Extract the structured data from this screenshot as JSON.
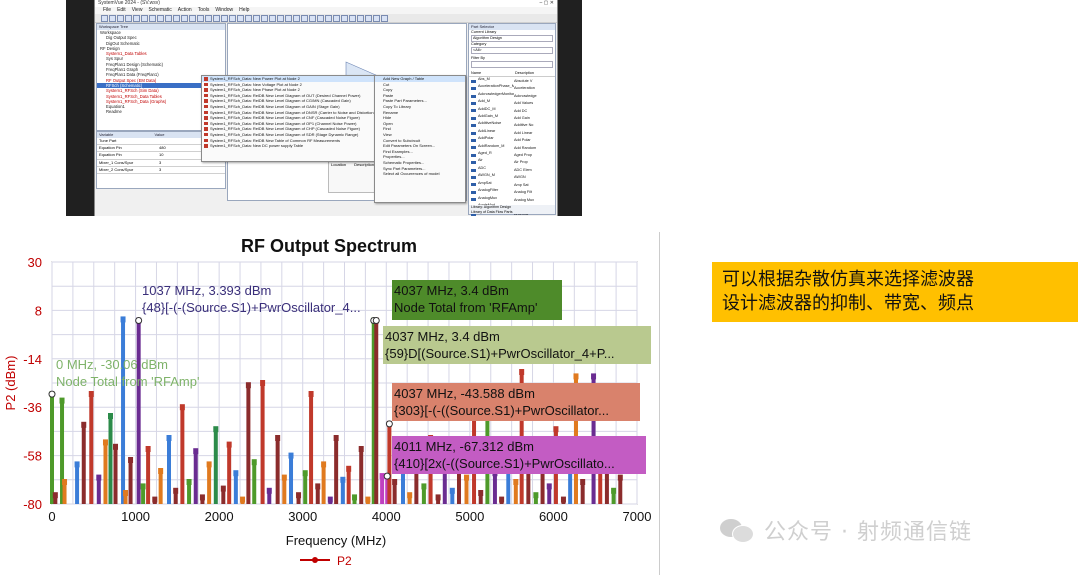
{
  "app": {
    "title": "SystemVue 2024 - (SV.wsv)",
    "menu": [
      "File",
      "Edit",
      "View",
      "Schematic",
      "Action",
      "Tools",
      "Window",
      "Help"
    ],
    "workspace_pane_title": "Workspace Tree",
    "tree": [
      {
        "label": "Workspace",
        "style": "normal"
      },
      {
        "label": "Dig Output Spec",
        "style": "normal"
      },
      {
        "label": "DigOut Schematic",
        "style": "normal"
      },
      {
        "label": "RF Design",
        "style": "normal"
      },
      {
        "label": "System1_Data Tables",
        "style": "red"
      },
      {
        "label": "Sys Spur",
        "style": "normal"
      },
      {
        "label": "FreqPlan1 Design (Schematic)",
        "style": "normal"
      },
      {
        "label": "FreqPlan1 Graph",
        "style": "normal"
      },
      {
        "label": "FreqPlan1 Data (FreqPlan1)",
        "style": "normal"
      },
      {
        "label": "RF Output Spec (EM Data)",
        "style": "red"
      },
      {
        "label": "RFSch (Schematic)",
        "style": "sel"
      },
      {
        "label": "System1_RFSch (Sim Data)",
        "style": "red"
      },
      {
        "label": "System1_RFSch_Data Tables",
        "style": "red"
      },
      {
        "label": "System1_RFSch_Data (Graphs)",
        "style": "red"
      },
      {
        "label": "Equation1",
        "style": "normal"
      },
      {
        "label": "Readme",
        "style": "normal"
      }
    ],
    "context_menu_left": [
      "System1_RFSch_Data: New Power Plot at Node 2",
      "System1_RFSch_Data: New Voltage Plot at Node 2",
      "System1_RFSch_Data: New Phase Plot at Node 2",
      "System1_RFSch_Data: RelDB New Level Diagram of OUT (Desired Channel Power)",
      "System1_RFSch_Data: RelDB New Level Diagram of CG/MN (Cascaded Gain)",
      "System1_RFSch_Data: RelDB New Level Diagram of GAIN (Stage Gain)",
      "System1_RFSch_Data: RelDB New Level Diagram of DNSR (Carrier to Noise and Distortion Ratio)",
      "System1_RFSch_Data: RelDB New Level Diagram of CNF (Cascaded Noise Figure)",
      "System1_RFSch_Data: RelDB New Level Diagram of OP1 (Channel Noise Power)",
      "System1_RFSch_Data: RelDB New Level Diagram of CHP (Cascaded Noise Figure)",
      "System1_RFSch_Data: RelDB New Level Diagram of SDR (Stage Dynamic Range)",
      "System1_RFSch_Data: RelDB New Table of Common RF Measurements",
      "System1_RFSch_Data: New DC power supply Table"
    ],
    "context_menu_right": [
      "Add New Graph / Table",
      "Cut",
      "Copy",
      "Paste",
      "Paste Part Parameters...",
      "Copy To Library",
      "Rename",
      "Hide",
      "Open",
      "Find",
      "View",
      "Convert to Subcircuit",
      "Edit Parameters On Screen...",
      "Find Examples...",
      "Properties...",
      "Schematic Properties...",
      "Sync Part Parameters...",
      "Select all Occurrences of model"
    ],
    "grid_header": [
      "Variable",
      "Value"
    ],
    "grid_rows": [
      [
        "Tune Part",
        ""
      ],
      [
        "Equation Pin",
        "480"
      ],
      [
        "Equation Pin",
        "10"
      ],
      [
        "Mixer_1 Cons/Spur",
        "3"
      ],
      [
        "Mixer_2 Cons/Spur",
        "3"
      ]
    ],
    "bottom_label": [
      "Location",
      "Description",
      "Units"
    ],
    "library_pane_title": "Part Selector",
    "library_current": "Algorithm Design",
    "library_category": "<All>",
    "library_filter_label": "Filter By",
    "library_columns": [
      "Name",
      "Description"
    ],
    "library_items": [
      [
        "Abs_M",
        "Absolute V"
      ],
      [
        "AccelerationPhase_M",
        "Acceleration"
      ],
      [
        "AcknowledgerMonitor",
        "Acknowledge"
      ],
      [
        "Add_M",
        "Add Values"
      ],
      [
        "AddDC_M",
        "Add DC"
      ],
      [
        "AddGain_M",
        "Add Gain"
      ],
      [
        "AdditiveNoise",
        "Additive No"
      ],
      [
        "AddLinear",
        "Add Linear"
      ],
      [
        "AddPolar",
        "Add Polar"
      ],
      [
        "AddRandom_M",
        "Add Random"
      ],
      [
        "Aged_R",
        "Aged Prop"
      ],
      [
        "Air",
        "Air Prop"
      ],
      [
        "ADC",
        "ADC Elem"
      ],
      [
        "AWGN_M",
        "AWGN"
      ],
      [
        "AmpSat",
        "Amp Sat"
      ],
      [
        "AnalogFilter",
        "Analog Filt"
      ],
      [
        "AnalogMux",
        "Analog Mux"
      ],
      [
        "AngleMod",
        "Angle Mod"
      ],
      [
        "Antenna",
        "Antenna"
      ],
      [
        "AntennaArray",
        "Ant Array"
      ],
      [
        "AnyFile",
        "Any File"
      ],
      [
        "ArrayPorts",
        "Array Ports"
      ],
      [
        "Attenuator",
        "Attenuator"
      ],
      [
        "Audio",
        "Audio"
      ],
      [
        "AutoCorr",
        "Auto Corr"
      ]
    ],
    "library_footer": [
      "Library: Algorithm Design",
      "Library of Data Flow Parts"
    ]
  },
  "chart_data": {
    "type": "bar",
    "title": "RF Output Spectrum",
    "xlabel": "Frequency (MHz)",
    "ylabel": "P2 (dBm)",
    "xlim": [
      0,
      7000
    ],
    "ylim": [
      -80,
      30
    ],
    "xticks": [
      "0",
      "1000",
      "2000",
      "3000",
      "4000",
      "5000",
      "6000",
      "7000"
    ],
    "yticks": [
      "30",
      "8",
      "-14",
      "-36",
      "-58",
      "-80"
    ],
    "grid": true,
    "legend": {
      "position": "bottom-center",
      "entries": [
        "P2"
      ]
    },
    "bars": [
      {
        "x": 0,
        "y": -30.06,
        "color": "#4e9a2a"
      },
      {
        "x": 40,
        "y": -76,
        "color": "#8b2c2c"
      },
      {
        "x": 120,
        "y": -33,
        "color": "#4e9a2a"
      },
      {
        "x": 150,
        "y": -70,
        "color": "#e07a1f"
      },
      {
        "x": 300,
        "y": -62,
        "color": "#3b7dd8"
      },
      {
        "x": 380,
        "y": -44,
        "color": "#8b2c2c"
      },
      {
        "x": 470,
        "y": -30,
        "color": "#c0392b"
      },
      {
        "x": 560,
        "y": -68,
        "color": "#6a2c91"
      },
      {
        "x": 640,
        "y": -52,
        "color": "#e07a1f"
      },
      {
        "x": 700,
        "y": -40,
        "color": "#2c8b4a"
      },
      {
        "x": 760,
        "y": -54,
        "color": "#8b2c2c"
      },
      {
        "x": 850,
        "y": 3.9,
        "color": "#3b7dd8"
      },
      {
        "x": 880,
        "y": -75,
        "color": "#e07a1f"
      },
      {
        "x": 940,
        "y": -60,
        "color": "#8b2c2c"
      },
      {
        "x": 1037,
        "y": 3.393,
        "color": "#6a2c91"
      },
      {
        "x": 1090,
        "y": -72,
        "color": "#4e9a2a"
      },
      {
        "x": 1150,
        "y": -55,
        "color": "#c0392b"
      },
      {
        "x": 1230,
        "y": -78,
        "color": "#8b2c2c"
      },
      {
        "x": 1300,
        "y": -65,
        "color": "#e07a1f"
      },
      {
        "x": 1400,
        "y": -50,
        "color": "#3b7dd8"
      },
      {
        "x": 1480,
        "y": -74,
        "color": "#8b2c2c"
      },
      {
        "x": 1560,
        "y": -36,
        "color": "#c0392b"
      },
      {
        "x": 1640,
        "y": -70,
        "color": "#4e9a2a"
      },
      {
        "x": 1720,
        "y": -56,
        "color": "#6a2c91"
      },
      {
        "x": 1800,
        "y": -77,
        "color": "#8b2c2c"
      },
      {
        "x": 1880,
        "y": -62,
        "color": "#e07a1f"
      },
      {
        "x": 1960,
        "y": -46,
        "color": "#2c8b4a"
      },
      {
        "x": 2050,
        "y": -73,
        "color": "#8b2c2c"
      },
      {
        "x": 2120,
        "y": -53,
        "color": "#c0392b"
      },
      {
        "x": 2200,
        "y": -66,
        "color": "#3b7dd8"
      },
      {
        "x": 2280,
        "y": -78,
        "color": "#e07a1f"
      },
      {
        "x": 2350,
        "y": -26,
        "color": "#8b2c2c"
      },
      {
        "x": 2420,
        "y": -61,
        "color": "#4e9a2a"
      },
      {
        "x": 2520,
        "y": -25,
        "color": "#c0392b"
      },
      {
        "x": 2600,
        "y": -74,
        "color": "#6a2c91"
      },
      {
        "x": 2700,
        "y": -50,
        "color": "#8b2c2c"
      },
      {
        "x": 2780,
        "y": -68,
        "color": "#e07a1f"
      },
      {
        "x": 2860,
        "y": -58,
        "color": "#3b7dd8"
      },
      {
        "x": 2950,
        "y": -76,
        "color": "#8b2c2c"
      },
      {
        "x": 3030,
        "y": -66,
        "color": "#4e9a2a"
      },
      {
        "x": 3100,
        "y": -30,
        "color": "#c0392b"
      },
      {
        "x": 3180,
        "y": -72,
        "color": "#8b2c2c"
      },
      {
        "x": 3250,
        "y": -62,
        "color": "#e07a1f"
      },
      {
        "x": 3330,
        "y": -78,
        "color": "#6a2c91"
      },
      {
        "x": 3400,
        "y": -50,
        "color": "#8b2c2c"
      },
      {
        "x": 3480,
        "y": -69,
        "color": "#3b7dd8"
      },
      {
        "x": 3550,
        "y": -64,
        "color": "#c0392b"
      },
      {
        "x": 3620,
        "y": -77,
        "color": "#4e9a2a"
      },
      {
        "x": 3700,
        "y": -55,
        "color": "#8b2c2c"
      },
      {
        "x": 3780,
        "y": -78,
        "color": "#e07a1f"
      },
      {
        "x": 3850,
        "y": 3.4,
        "color": "#4e9a2a"
      },
      {
        "x": 3880,
        "y": 3.4,
        "color": "#8b2c2c"
      },
      {
        "x": 3950,
        "y": -67.312,
        "color": "#c040c0"
      },
      {
        "x": 4011,
        "y": -67.312,
        "color": "#c040c0"
      },
      {
        "x": 4037,
        "y": -43.588,
        "color": "#c0392b"
      },
      {
        "x": 4100,
        "y": -70,
        "color": "#8b2c2c"
      },
      {
        "x": 4200,
        "y": -58,
        "color": "#3b7dd8"
      },
      {
        "x": 4280,
        "y": -76,
        "color": "#e07a1f"
      },
      {
        "x": 4360,
        "y": -64,
        "color": "#8b2c2c"
      },
      {
        "x": 4450,
        "y": -72,
        "color": "#4e9a2a"
      },
      {
        "x": 4530,
        "y": -50,
        "color": "#c0392b"
      },
      {
        "x": 4620,
        "y": -77,
        "color": "#8b2c2c"
      },
      {
        "x": 4700,
        "y": -62,
        "color": "#6a2c91"
      },
      {
        "x": 4790,
        "y": -74,
        "color": "#3b7dd8"
      },
      {
        "x": 4870,
        "y": -56,
        "color": "#8b2c2c"
      },
      {
        "x": 4960,
        "y": -68,
        "color": "#e07a1f"
      },
      {
        "x": 5050,
        "y": -40,
        "color": "#c0392b"
      },
      {
        "x": 5130,
        "y": -75,
        "color": "#8b2c2c"
      },
      {
        "x": 5210,
        "y": -30,
        "color": "#4e9a2a"
      },
      {
        "x": 5300,
        "y": -66,
        "color": "#6a2c91"
      },
      {
        "x": 5380,
        "y": -78,
        "color": "#8b2c2c"
      },
      {
        "x": 5460,
        "y": -52,
        "color": "#3b7dd8"
      },
      {
        "x": 5550,
        "y": -70,
        "color": "#e07a1f"
      },
      {
        "x": 5620,
        "y": -20,
        "color": "#c0392b"
      },
      {
        "x": 5700,
        "y": -62,
        "color": "#8b2c2c"
      },
      {
        "x": 5790,
        "y": -76,
        "color": "#4e9a2a"
      },
      {
        "x": 5870,
        "y": -58,
        "color": "#8b2c2c"
      },
      {
        "x": 5950,
        "y": -72,
        "color": "#6a2c91"
      },
      {
        "x": 6030,
        "y": -46,
        "color": "#c0392b"
      },
      {
        "x": 6120,
        "y": -78,
        "color": "#8b2c2c"
      },
      {
        "x": 6200,
        "y": -65,
        "color": "#3b7dd8"
      },
      {
        "x": 6270,
        "y": -22,
        "color": "#e07a1f"
      },
      {
        "x": 6350,
        "y": -70,
        "color": "#8b2c2c"
      },
      {
        "x": 6480,
        "y": -22,
        "color": "#6a2c91"
      },
      {
        "x": 6560,
        "y": -60,
        "color": "#c0392b"
      },
      {
        "x": 6640,
        "y": -52,
        "color": "#8b2c2c"
      },
      {
        "x": 6720,
        "y": -74,
        "color": "#4e9a2a"
      },
      {
        "x": 6800,
        "y": -68,
        "color": "#8b2c2c"
      }
    ],
    "annotations": [
      {
        "x": 1037,
        "y": 3.393,
        "lines": [
          "1037 MHz, 3.393 dBm",
          "{48}[-(-(Source.S1)+PwrOscillator_4..."
        ],
        "box_color": "",
        "text_color": "#3a2f7a"
      },
      {
        "x": 0,
        "y": -30.06,
        "lines": [
          "0 MHz, -30.06 dBm",
          "Node Total from 'RFAmp'"
        ],
        "box_color": "",
        "text_color": "#7fb36a"
      },
      {
        "x": 3850,
        "y": 3.4,
        "lines": [
          "4037 MHz, 3.4 dBm",
          "Node Total from 'RFAmp'"
        ],
        "box_color": "#4e8b2a",
        "text_color": "#111111"
      },
      {
        "x": 3880,
        "y": 3.4,
        "lines": [
          "4037 MHz, 3.4 dBm",
          "{59}D[(Source.S1)+PwrOscillator_4+P..."
        ],
        "box_color": "#b9c98f",
        "text_color": "#111111"
      },
      {
        "x": 4037,
        "y": -43.588,
        "lines": [
          "4037 MHz, -43.588 dBm",
          "{303}[-(-((Source.S1)+PwrOscillator..."
        ],
        "box_color": "#d9826c",
        "text_color": "#111111"
      },
      {
        "x": 4011,
        "y": -67.312,
        "lines": [
          "4011 MHz, -67.312 dBm",
          "{410}[2x(-((Source.S1)+PwrOscillato..."
        ],
        "box_color": "#c35cc3",
        "text_color": "#111111"
      }
    ]
  },
  "note": {
    "line1": "可以根据杂散仿真来选择滤波器",
    "line2": "设计滤波器的抑制、带宽、频点"
  },
  "watermark": {
    "text": "公众号 · 射频通信链"
  }
}
